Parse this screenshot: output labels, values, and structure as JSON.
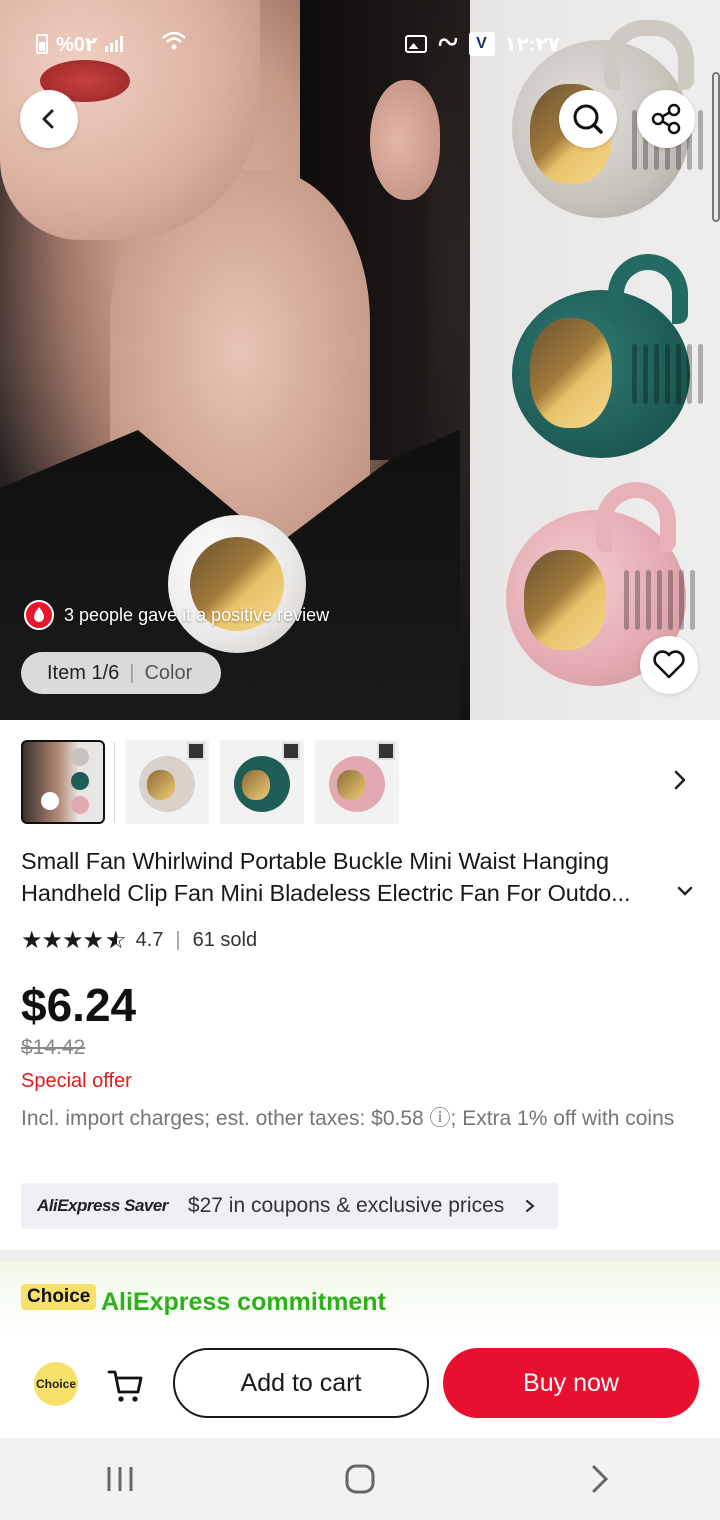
{
  "status_bar": {
    "battery_text": "%0٢",
    "time": "١٢:٢٧"
  },
  "hero": {
    "review_text": "3 people gave it a positive review",
    "item_counter": "Item 1/6",
    "variant_tab": "Color"
  },
  "thumbnails": {
    "items": [
      {
        "color": "#e8e6e4",
        "active": true
      },
      {
        "color": "#d9d2cc",
        "active": false
      },
      {
        "color": "#1f5e57",
        "active": false
      },
      {
        "color": "#e2aab0",
        "active": false
      }
    ]
  },
  "product": {
    "title": "Small Fan Whirlwind Portable Buckle Mini Waist Hanging Handheld Clip Fan Mini Bladeless Electric Fan  For Outdo...",
    "rating": "4.7",
    "sold": "61 sold",
    "price": "$6.24",
    "original_price": "$14.42",
    "special_offer": "Special offer",
    "taxes_note": "Incl. import charges; est. other taxes: $0.58 ⓘ; Extra 1% off with coins"
  },
  "saver": {
    "logo": "AliExpress Saver",
    "text": "$27 in coupons & exclusive prices"
  },
  "commitment": {
    "badge": "Choice",
    "text": "AliExpress commitment"
  },
  "actions": {
    "choice_label": "Choice",
    "add_to_cart": "Add to cart",
    "buy_now": "Buy now"
  },
  "colors": {
    "accent_red": "#e8102e",
    "special_red": "#e5181b",
    "commit_green": "#2bb219",
    "choice_yellow": "#f8e16b"
  }
}
